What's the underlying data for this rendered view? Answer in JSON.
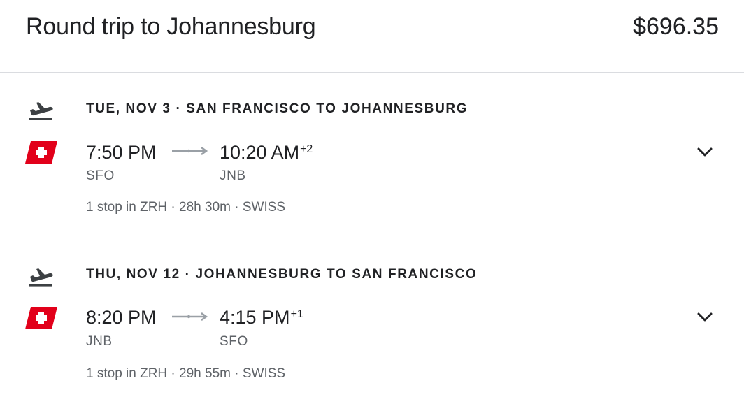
{
  "header": {
    "title": "Round trip to Johannesburg",
    "price": "$696.35"
  },
  "legs": [
    {
      "direction_icon": "takeoff-icon",
      "heading": "TUE, NOV 3 · SAN FRANCISCO TO JOHANNESBURG",
      "airline_logo": "swiss-airline-logo",
      "depart_time": "7:50 PM",
      "arrive_time": "10:20 AM",
      "arrive_day_offset": "+2",
      "depart_code": "SFO",
      "arrive_code": "JNB",
      "details": "1 stop in ZRH · 28h 30m · SWISS",
      "expand_icon": "chevron-down-icon"
    },
    {
      "direction_icon": "takeoff-icon",
      "heading": "THU, NOV 12 · JOHANNESBURG TO SAN FRANCISCO",
      "airline_logo": "swiss-airline-logo",
      "depart_time": "8:20 PM",
      "arrive_time": "4:15 PM",
      "arrive_day_offset": "+1",
      "depart_code": "JNB",
      "arrive_code": "SFO",
      "details": "1 stop in ZRH · 29h 55m · SWISS",
      "expand_icon": "chevron-down-icon"
    }
  ],
  "colors": {
    "text_primary": "#202124",
    "text_secondary": "#5f6368",
    "divider": "#dadce0",
    "swiss_red": "#e2001a",
    "icon_gray": "#3c4043"
  }
}
